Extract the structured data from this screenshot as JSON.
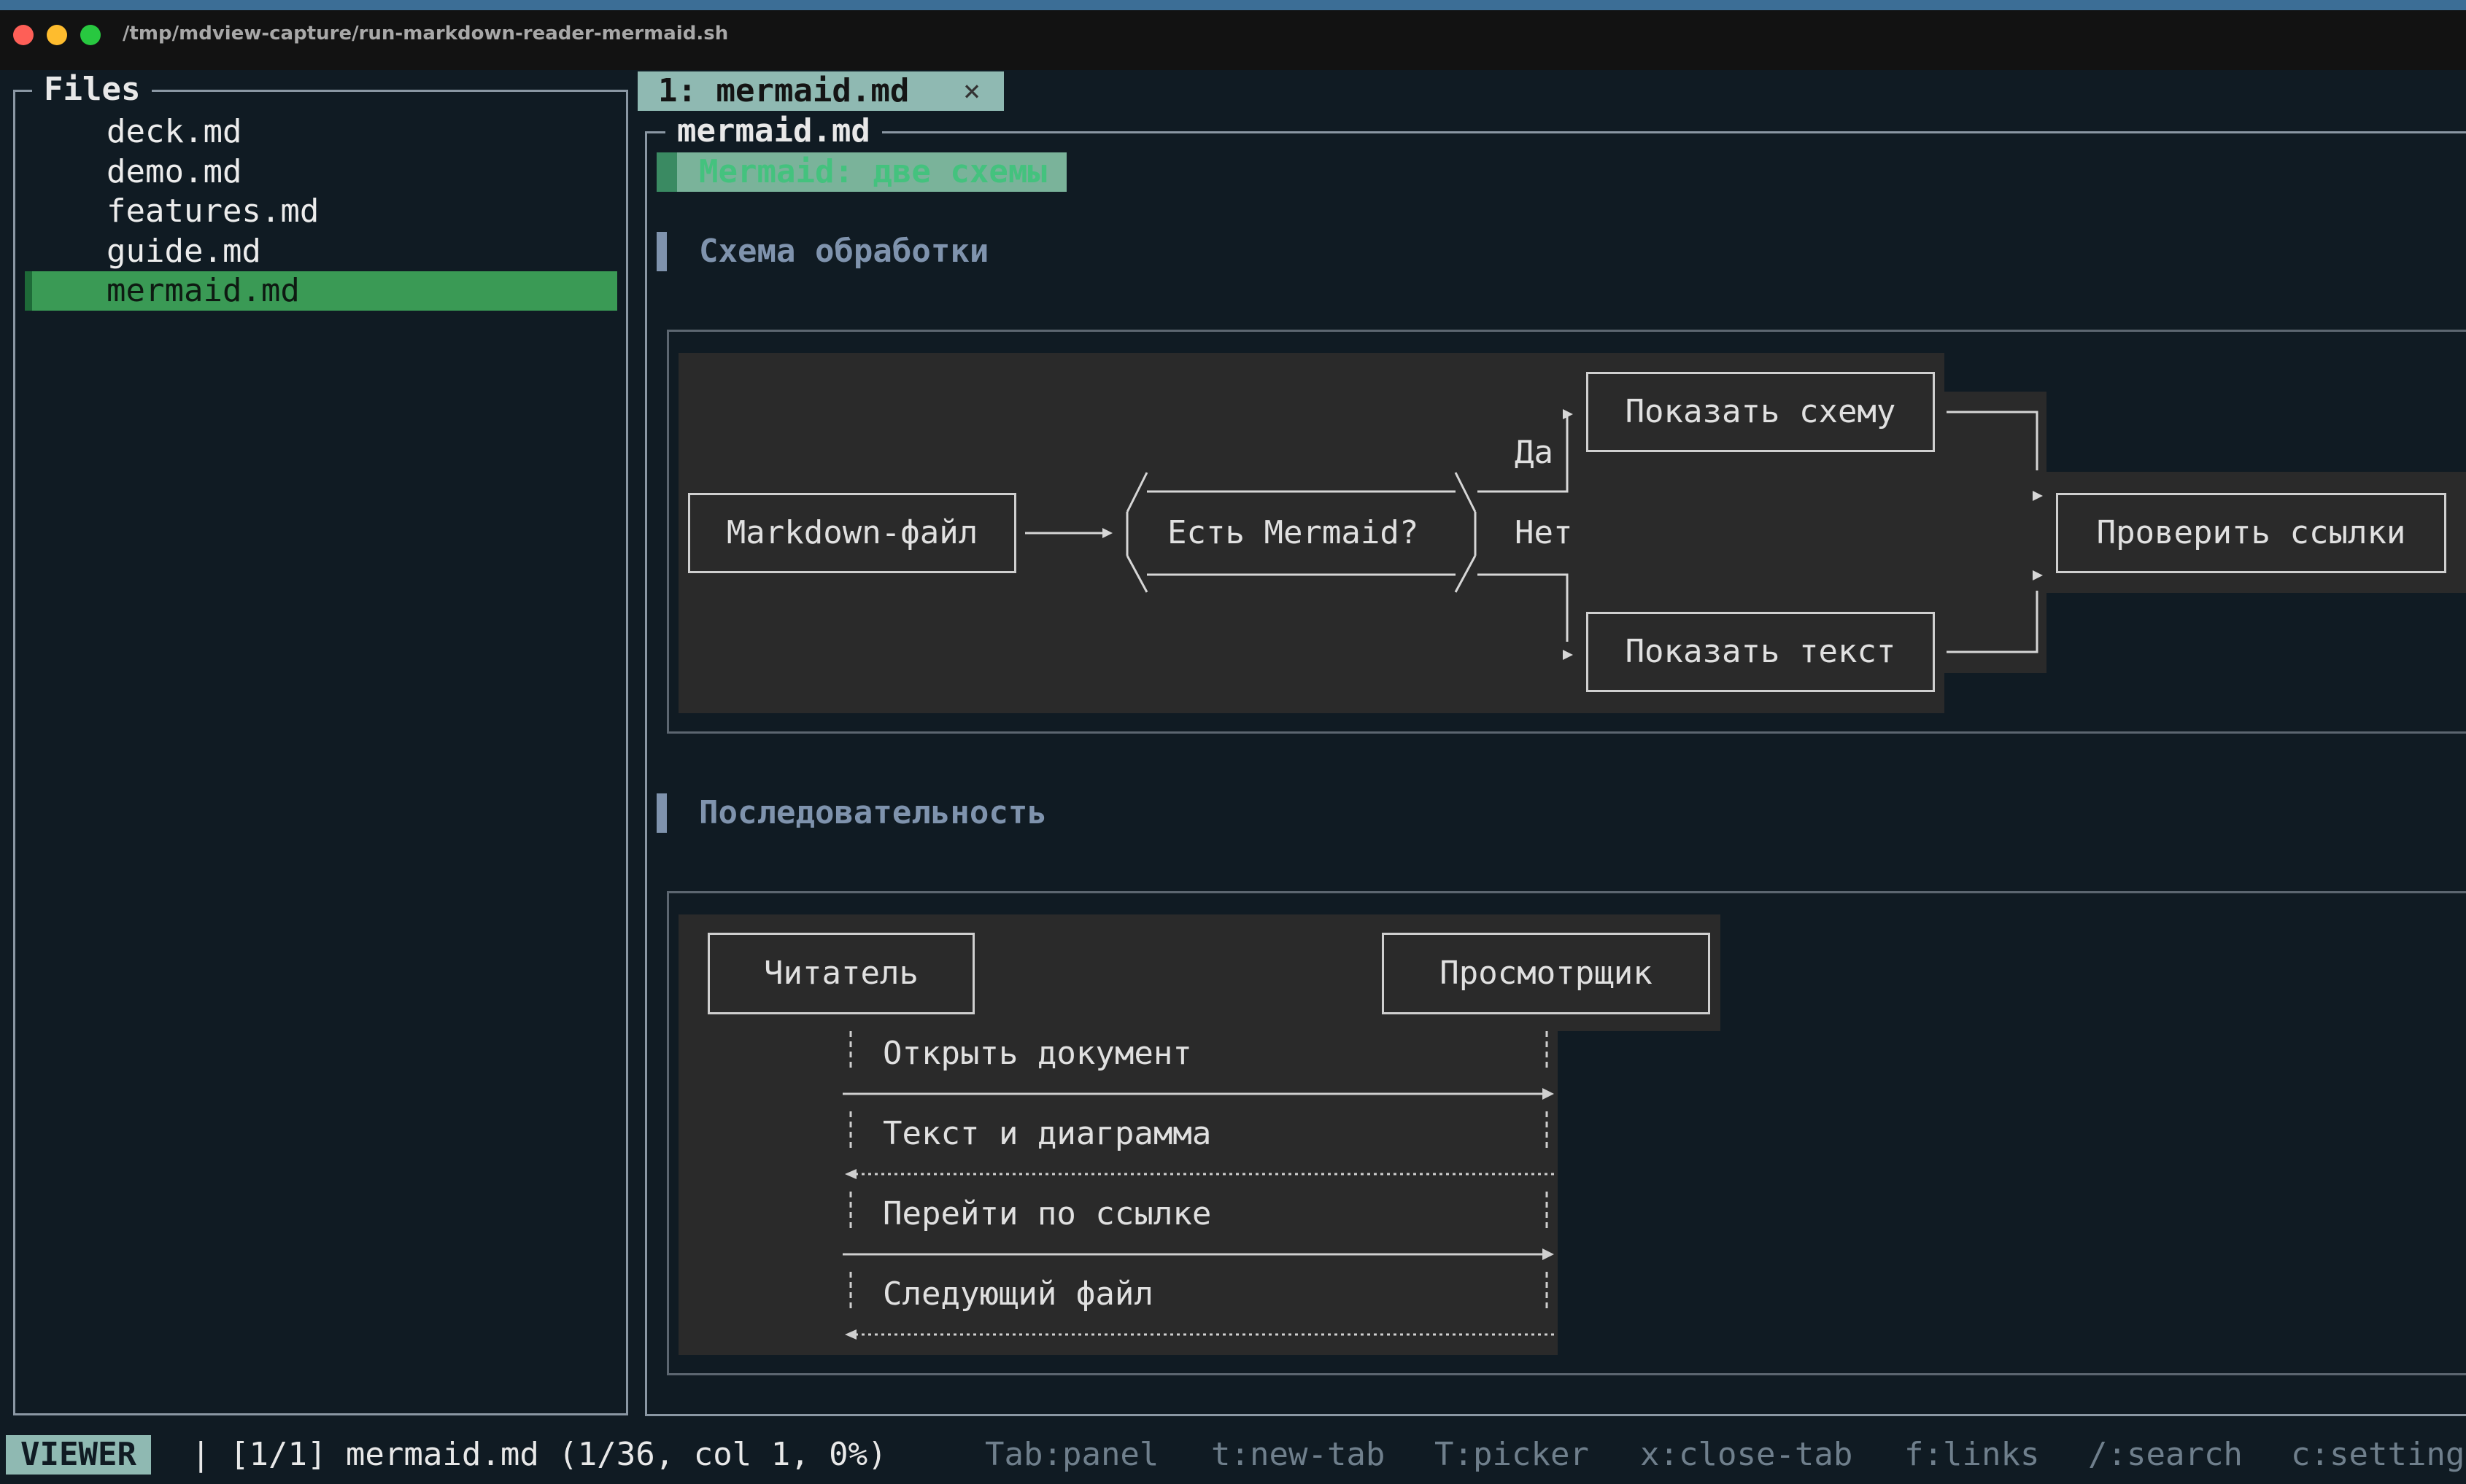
{
  "window": {
    "title": "/tmp/mdview-capture/run-markdown-reader-mermaid.sh"
  },
  "sidebar": {
    "title": "Files",
    "items": [
      {
        "label": "deck.md"
      },
      {
        "label": "demo.md"
      },
      {
        "label": "features.md"
      },
      {
        "label": "guide.md"
      },
      {
        "label": "mermaid.md",
        "selected": true
      }
    ]
  },
  "tabs": [
    {
      "label": "1: mermaid.md",
      "close": "×"
    }
  ],
  "viewer": {
    "panel_title": "mermaid.md",
    "doc_title": "Mermaid: две схемы",
    "section1": "Схема обработки",
    "section2": "Последовательность"
  },
  "flowchart": {
    "nodes": {
      "start": "Markdown-файл",
      "decision": "Есть Mermaid?",
      "show_diagram": "Показать схему",
      "show_text": "Показать текст",
      "check_links": "Проверить ссылки"
    },
    "edges": {
      "yes": "Да",
      "no": "Нет"
    }
  },
  "sequence": {
    "actors": {
      "reader": "Читатель",
      "viewer": "Просмотрщик"
    },
    "messages": [
      {
        "text": "Открыть документ",
        "direction": "right"
      },
      {
        "text": "Текст и диаграмма",
        "direction": "left",
        "dotted": true
      },
      {
        "text": "Перейти по ссылке",
        "direction": "right"
      },
      {
        "text": "Следующий файл",
        "direction": "left",
        "dotted": true
      }
    ]
  },
  "statusbar": {
    "mode": "VIEWER",
    "info": "| [1/1] mermaid.md (1/36, col 1, 0%)",
    "keys": [
      "Tab:panel",
      "t:new-tab",
      "T:picker",
      "x:close-tab",
      "f:links",
      "/:search",
      "c:settings"
    ]
  },
  "colors": {
    "background": "#101b23",
    "accent_selected": "#3a9a55",
    "tab": "#8fb9b2",
    "heading": "#7f93ad",
    "doc_title": "#44c27e"
  }
}
